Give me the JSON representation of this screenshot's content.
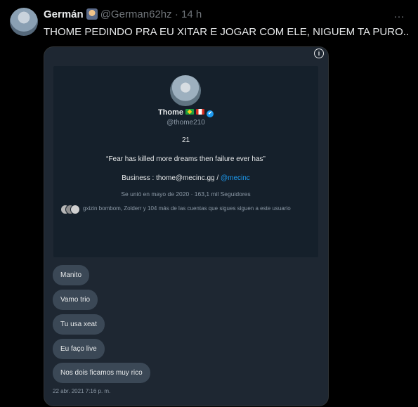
{
  "tweet": {
    "author_name": "Germán",
    "author_emoji": "construction-worker-emoji",
    "handle": "@German62hz",
    "separator": "·",
    "time": "14 h",
    "more_icon": "…",
    "text": "THOME PEDINDO PRA EU XITAR E JOGAR COM ELE, NIGUEM TA PURO.."
  },
  "media": {
    "info_icon": "i",
    "profile": {
      "name": "Thome",
      "flags": [
        "brazil-flag",
        "canada-flag"
      ],
      "verified_icon": "✔",
      "handle": "@thome210",
      "age": "21",
      "quote": "“Fear has killed more dreams then failure ever has”",
      "business_prefix": "Business : thome@mecinc.gg / ",
      "business_link": "@mecinc",
      "joined": "Se unió en mayo de 2020 · 163,1 mil Seguidores",
      "followers_you_know": "gxizin bombom, Zolderr y 104 más de las cuentas que sigues siguen a este usuario"
    },
    "messages": [
      "Manito",
      "Vamo trio",
      "Tu usa xeat",
      "Eu faço live",
      "Nos dois ficamos muy rico"
    ],
    "message_time": "22 abr. 2021 7:16 p. m."
  },
  "colors": {
    "background": "#000000",
    "media_background": "#1e2732",
    "card_background": "#15202b",
    "bubble": "#3b4856",
    "link": "#1d9bf0"
  }
}
